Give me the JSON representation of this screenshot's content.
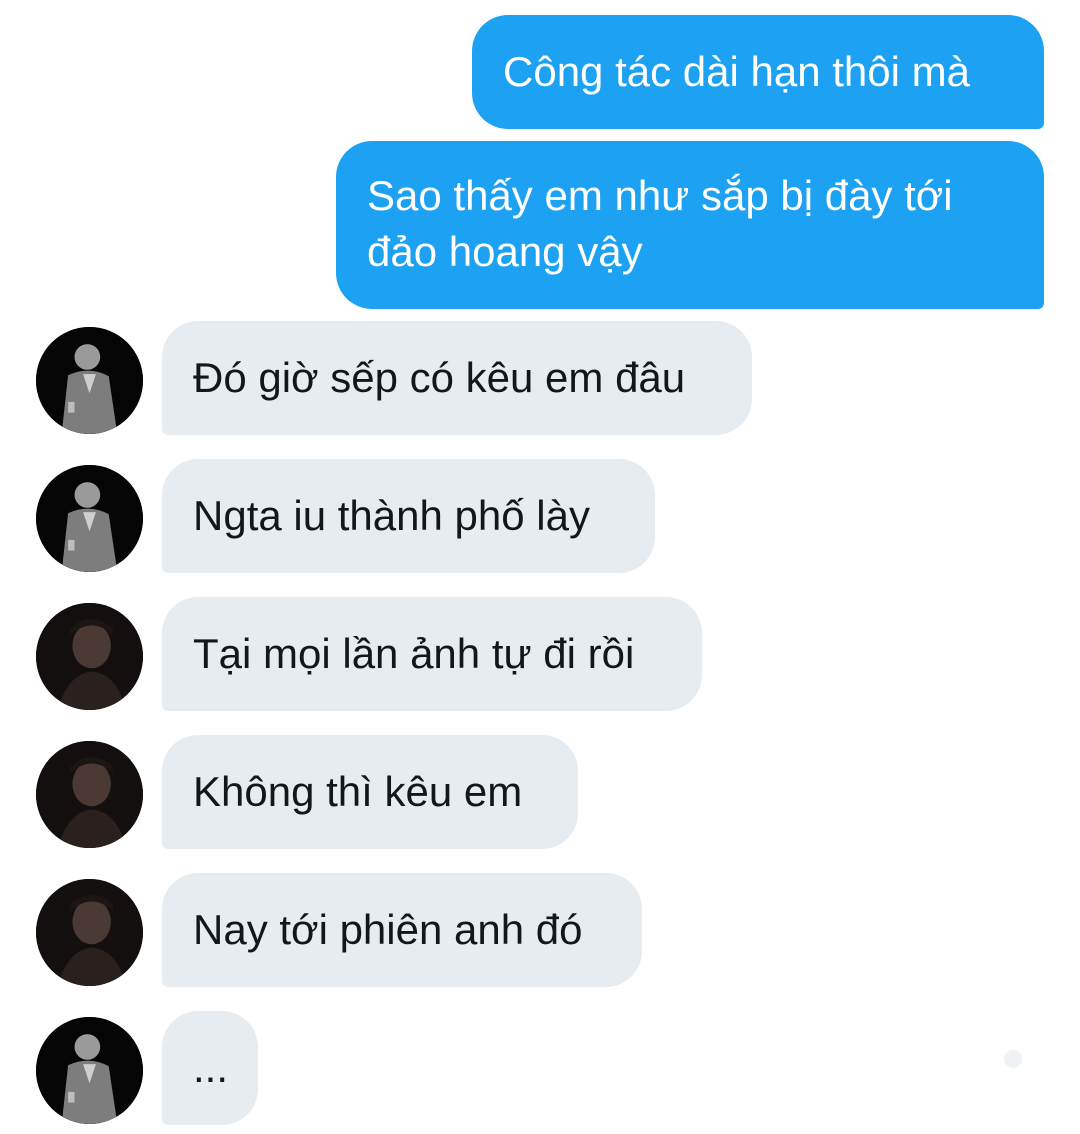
{
  "conversation": {
    "outgoing": [
      {
        "lines": [
          "Công tác dài hạn thôi mà"
        ]
      },
      {
        "lines": [
          "Sao thấy em như sắp bị đày tới",
          "đảo hoang vậy"
        ]
      }
    ],
    "incoming": [
      {
        "avatar": "avatar-grey-jacket",
        "text": "Đó giờ sếp có kêu em đâu"
      },
      {
        "avatar": "avatar-grey-jacket",
        "text": "Ngta iu thành phố lày"
      },
      {
        "avatar": "avatar-dark-portrait",
        "text": "Tại mọi lần ảnh tự đi rồi"
      },
      {
        "avatar": "avatar-dark-portrait",
        "text": "Không thì kêu em"
      },
      {
        "avatar": "avatar-dark-portrait",
        "text": "Nay tới phiên anh đó"
      },
      {
        "avatar": "avatar-grey-jacket",
        "text": "..."
      }
    ]
  },
  "colors": {
    "outgoing_bubble": "#1da1f2",
    "incoming_bubble": "#e6ecf0",
    "incoming_text": "#14171a",
    "outgoing_text": "#ffffff"
  }
}
